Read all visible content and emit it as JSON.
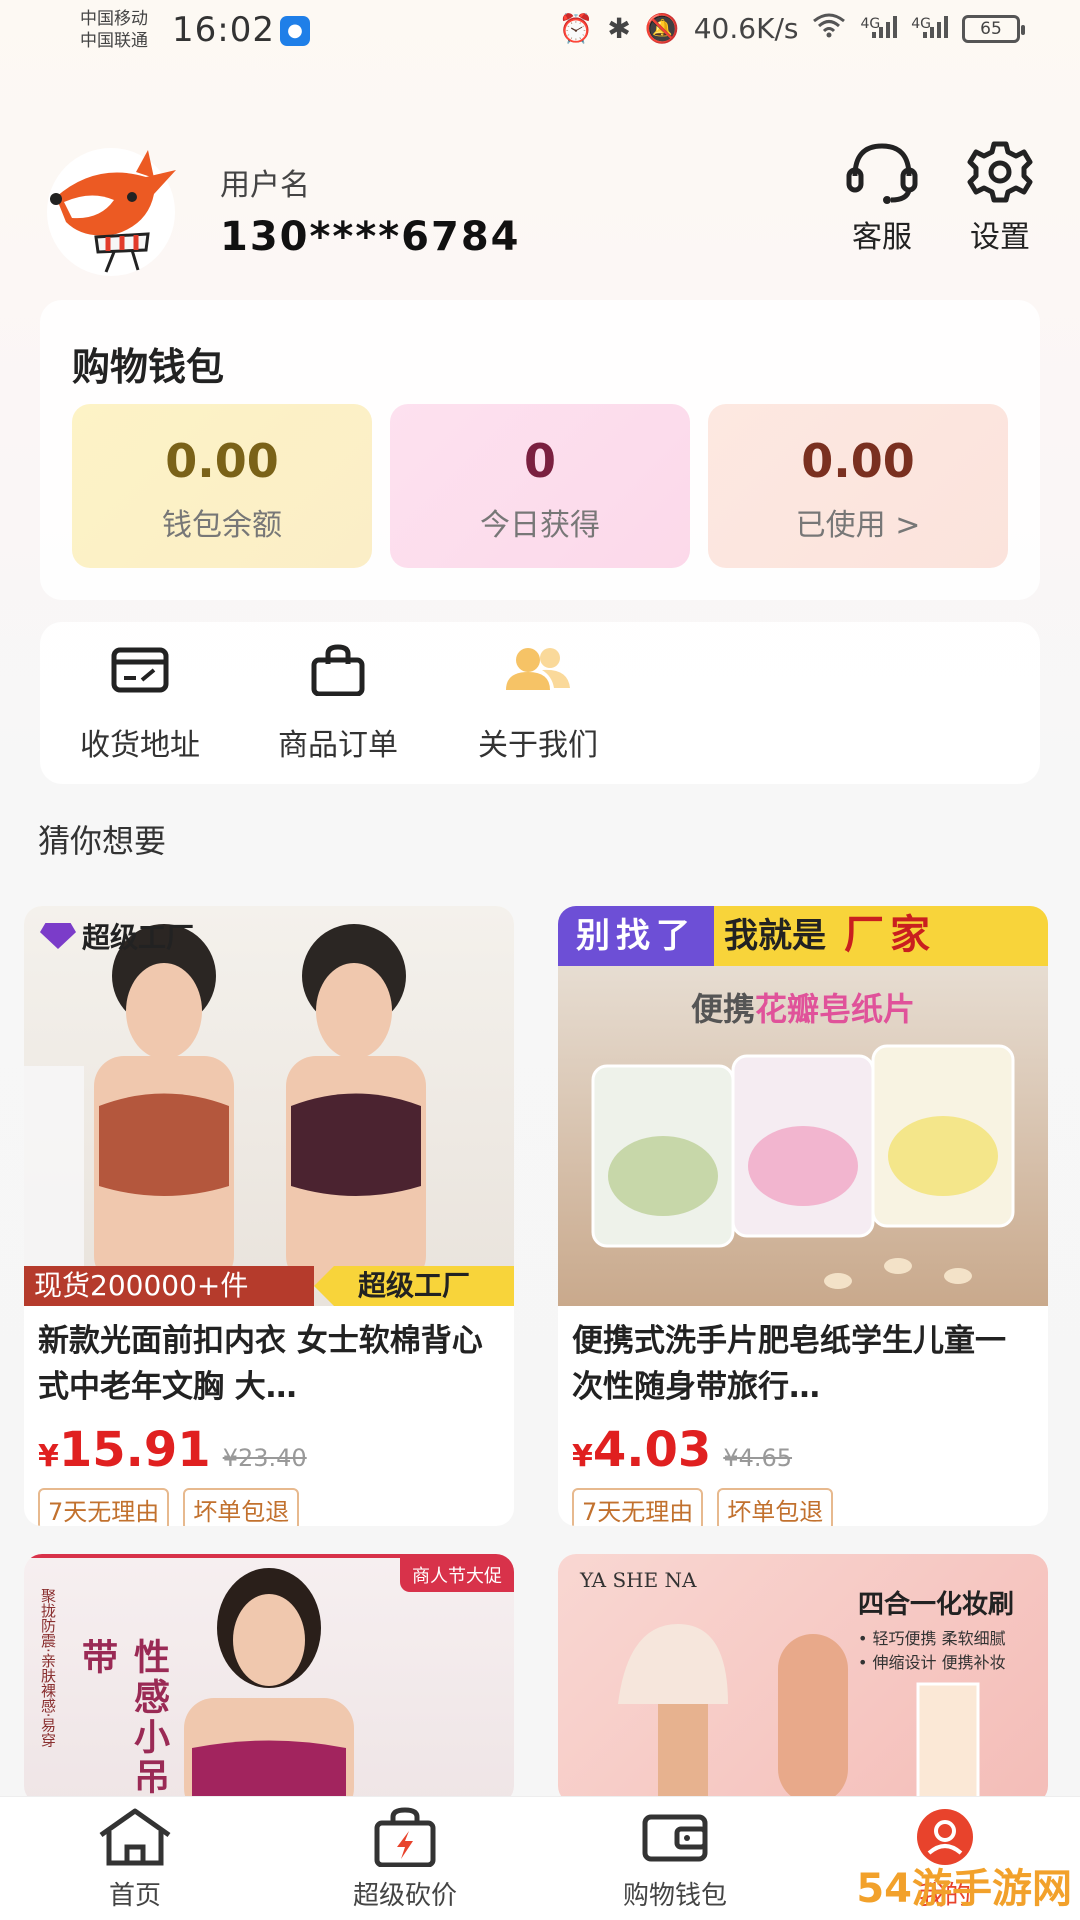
{
  "status_bar": {
    "carrier1": "中国移动",
    "carrier2": "中国联通",
    "time": "16:02",
    "speed": "40.6K/s",
    "net1": "4G",
    "net2": "4G",
    "battery": "65"
  },
  "profile": {
    "username_label": "用户名",
    "phone": "130****6784",
    "service_label": "客服",
    "settings_label": "设置"
  },
  "wallet": {
    "title": "购物钱包",
    "balance_value": "0.00",
    "balance_label": "钱包余额",
    "today_value": "0",
    "today_label": "今日获得",
    "used_value": "0.00",
    "used_label": "已使用 >"
  },
  "shortcuts": {
    "address": "收货地址",
    "orders": "商品订单",
    "about": "关于我们"
  },
  "section": {
    "guess_title": "猜你想要"
  },
  "products": [
    {
      "title": "新款光面前扣内衣 女士软棉背心式中老年文胸 大…",
      "currency": "¥",
      "price": "15.91",
      "old_price": "¥23.40",
      "tag1": "7天无理由",
      "tag2": "坏单包退",
      "badge_top": "超级工厂",
      "banner_left": "现货200000+件",
      "banner_right": "超级工厂"
    },
    {
      "title": "便携式洗手片肥皂纸学生儿童一次性随身带旅行…",
      "currency": "¥",
      "price": "4.03",
      "old_price": "¥4.65",
      "tag1": "7天无理由",
      "tag2": "坏单包退",
      "banner_a": "别找了",
      "banner_b": "我就是",
      "banner_c": "厂家",
      "subtitle_a": "便携",
      "subtitle_b": "花瓣皂纸片"
    },
    {
      "badge": "商人节大促",
      "vertical": "性感小吊带",
      "side_text": "聚拢防震·亲肤裸感·易穿"
    },
    {
      "brand": "YA SHE NA",
      "headline": "四合一化妆刷",
      "point1": "• 轻巧便携 柔软细腻",
      "point2": "• 伸缩设计 便携补妆"
    }
  ],
  "nav": {
    "home": "首页",
    "bargain": "超级砍价",
    "wallet": "购物钱包",
    "me": "我的"
  },
  "watermark": "54游手游网"
}
